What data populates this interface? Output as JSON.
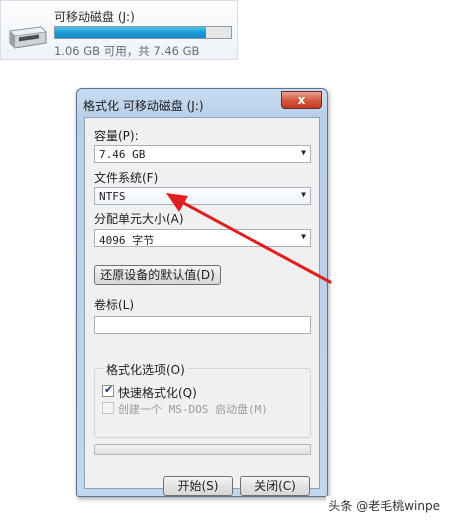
{
  "drive": {
    "name": "可移动磁盘 (J:)",
    "space_text": "1.06 GB 可用，共 7.46 GB",
    "used_fraction": 0.86,
    "bar_color": "#1c9bd6"
  },
  "dialog": {
    "title": "格式化 可移动磁盘 (J:)",
    "close_label": "x",
    "capacity_label": "容量(P):",
    "capacity_value": "7.46 GB",
    "filesystem_label": "文件系统(F)",
    "filesystem_value": "NTFS",
    "allocation_label": "分配单元大小(A)",
    "allocation_value": "4096 字节",
    "restore_button": "还原设备的默认值(D)",
    "volume_label": "卷标(L)",
    "volume_value": "",
    "options_title": "格式化选项(O)",
    "quick_format_label": "快速格式化(Q)",
    "quick_format_checked": true,
    "msdos_label": "创建一个 MS-DOS 启动盘(M)",
    "msdos_checked": false,
    "start_button": "开始(S)",
    "close_button": "关闭(C)"
  },
  "icons": {
    "dropdown": "chevron-down-icon",
    "drive": "removable-drive-icon",
    "check": "checkmark-icon"
  },
  "annotation_color": "#e02020",
  "watermark": "头条 @老毛桃winpe"
}
